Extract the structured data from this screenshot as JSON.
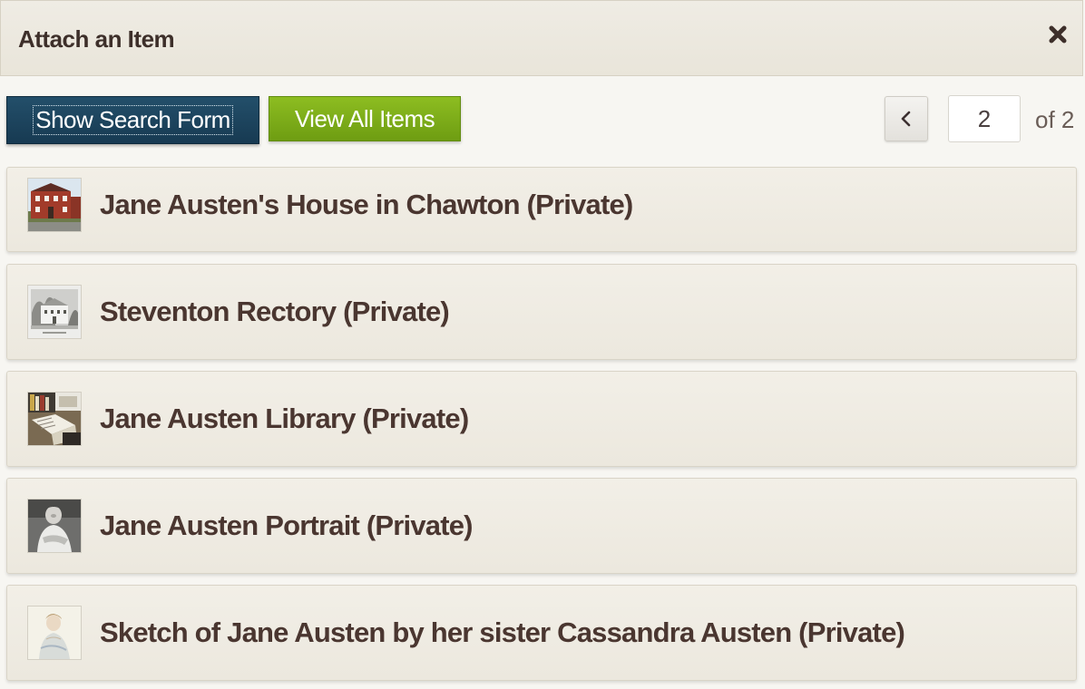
{
  "dialog": {
    "title": "Attach an Item",
    "close_icon": "close-icon"
  },
  "toolbar": {
    "search_form_label": "Show Search Form",
    "view_all_label": "View All Items",
    "search_button_color": "#1b445e",
    "view_all_button_color": "#7aac17"
  },
  "pagination": {
    "prev_icon": "chevron-left-icon",
    "current_page": "2",
    "total_label": "of 2"
  },
  "items": [
    {
      "title": "Jane Austen's House in Chawton (Private)",
      "thumb_icon": "house-photo-thumbnail"
    },
    {
      "title": "Steventon Rectory (Private)",
      "thumb_icon": "rectory-engraving-thumbnail"
    },
    {
      "title": "Jane Austen Library (Private)",
      "thumb_icon": "library-photo-thumbnail"
    },
    {
      "title": "Jane Austen Portrait (Private)",
      "thumb_icon": "portrait-thumbnail"
    },
    {
      "title": "Sketch of Jane Austen by her sister Cassandra Austen (Private)",
      "thumb_icon": "sketch-thumbnail"
    }
  ]
}
